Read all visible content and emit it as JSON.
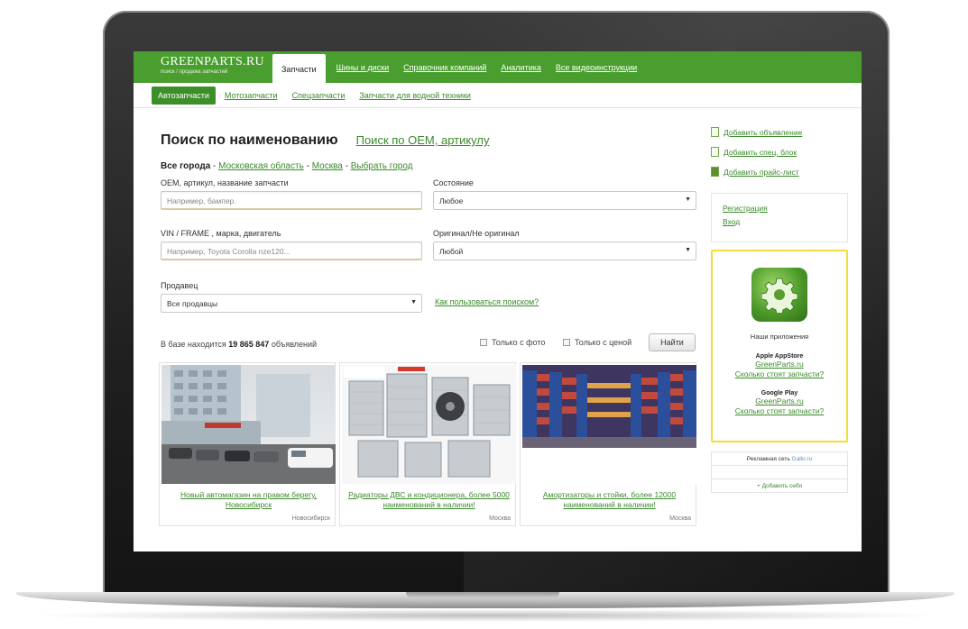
{
  "site": {
    "logo_title": "GREENPARTS.RU",
    "logo_subtitle": "поиск / продажа запчастей"
  },
  "top_nav": [
    {
      "label": "Запчасти",
      "active": true
    },
    {
      "label": "Шины и диски",
      "active": false
    },
    {
      "label": "Справочник компаний",
      "active": false
    },
    {
      "label": "Аналитика",
      "active": false
    },
    {
      "label": "Все видеоинструкции",
      "active": false
    }
  ],
  "sub_nav": [
    {
      "label": "Автозапчасти",
      "active": true
    },
    {
      "label": "Мотозапчасти",
      "active": false
    },
    {
      "label": "Спецзапчасти",
      "active": false
    },
    {
      "label": "Запчасти для водной техники",
      "active": false
    }
  ],
  "search": {
    "heading": "Поиск по наименованию",
    "alt_link": "Поиск по OEM, артикулу",
    "region_all": "Все города",
    "region_links": [
      "Московская область",
      "Москва",
      "Выбрать город"
    ],
    "region_sep": " - ",
    "oem_label": "OEM, артикул, название запчасти",
    "oem_placeholder": "Например, бампер.",
    "state_label": "Состояние",
    "state_value": "Любое",
    "vin_label": "VIN / FRAME , марка, двигатель",
    "vin_placeholder": "Например, Toyota Corolla nze120...",
    "original_label": "Оригинал/Не оригинал",
    "original_value": "Любой",
    "seller_label": "Продавец",
    "seller_value": "Все продавцы",
    "help_link": "Как пользоваться поиском?"
  },
  "results_bar": {
    "count_prefix": "В базе находится",
    "count_value": "19 865 847",
    "count_suffix": "объявлений",
    "only_photo": "Только с фото",
    "only_price": "Только с ценой",
    "find_button": "Найти"
  },
  "cards": [
    {
      "title": "Новый автомагазин на правом берегу, Новосибирск",
      "city": "Новосибирск"
    },
    {
      "title": "Радиаторы ДВС и кондиционера, более 5000 наименований в наличии!",
      "city": "Москва"
    },
    {
      "title": "Амортизаторы и стойки, более 12000 наименований в наличии!",
      "city": "Москва"
    }
  ],
  "sidebar": {
    "links": [
      "Добавить объявление",
      "Добавить спец. блок",
      "Добавить прайс-лист"
    ],
    "auth": [
      "Регистрация",
      "Вход"
    ],
    "apps_caption": "Наши приложения",
    "stores": [
      {
        "name": "Apple AppStore",
        "link1": "GreenParts.ru",
        "link2": "Сколько стоят запчасти?"
      },
      {
        "name": "Google Play",
        "link1": "GreenParts.ru",
        "link2": "Сколько стоят запчасти?"
      }
    ],
    "ad_network_label": "Рекламная сеть",
    "ad_network_brand": "Gallo.ru",
    "ad_add": "+ Добавить себя"
  },
  "colors": {
    "brand_green": "#4a9e2f",
    "link_green": "#3a8a2a",
    "app_border": "#f2dd3a"
  }
}
